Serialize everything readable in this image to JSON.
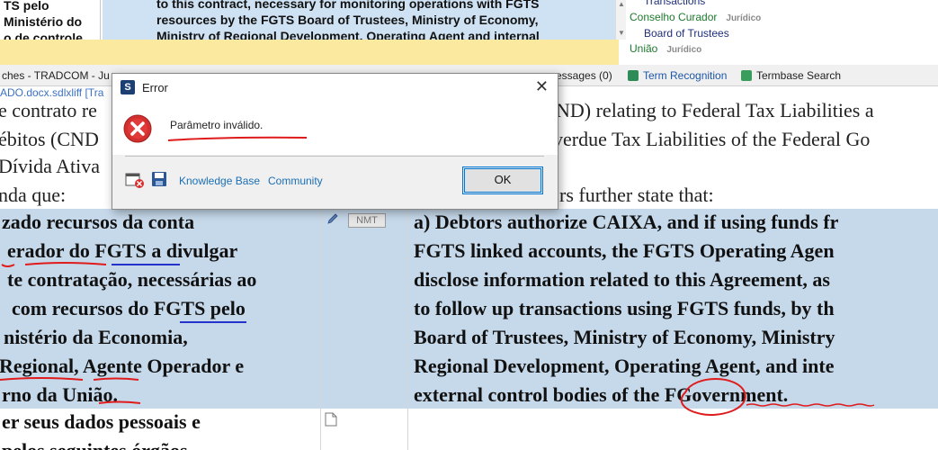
{
  "top_left": {
    "lines": [
      "TS pelo",
      "Ministério do",
      "o de controle"
    ]
  },
  "top_preview": {
    "lines": [
      "to this contract, necessary for monitoring operations with FGTS",
      "resources by the FGTS Board of Trustees, Ministry of Economy,",
      "Ministry of Regional Development, Operating Agent and internal"
    ]
  },
  "termbase": {
    "rows": [
      {
        "term": "Transactions",
        "tag": ""
      },
      {
        "term": "Conselho Curador",
        "tag": "Jurídico"
      },
      {
        "term": "Board of Trustees",
        "tag": ""
      },
      {
        "term": "União",
        "tag": "Jurídico"
      }
    ]
  },
  "tabs": {
    "searches": "ches - TRADCOM - Ju",
    "messages": "essages (0)",
    "term_recognition": "Term Recognition",
    "termbase_search": "Termbase Search"
  },
  "file_tab": "ADO.docx.sdlxliff [Tra",
  "editor": {
    "row1": {
      "src": "e contrato re",
      "tgt": "ND) relating to Federal Tax Liabilities a"
    },
    "row2": {
      "src": "ébitos (CND",
      "tgt": "verdue Tax Liabilities of the Federal Go"
    },
    "row3": {
      "src": "Dívida Ativa",
      "tgt": ""
    },
    "row4": {
      "src": "nda que:",
      "tgt": "rs further state that:"
    },
    "active": {
      "badge": "NMT",
      "src_lines": [
        "zado recursos da conta",
        "erador do FGTS a divulgar",
        "te contratação, necessárias ao",
        "com recursos do FGTS pelo",
        "nistério da Economia,",
        "Regional, Agente Operador e",
        "rno da União."
      ],
      "tgt_lines": [
        "a) Debtors authorize CAIXA, and if using funds fr",
        "FGTS linked accounts, the FGTS Operating Agen",
        "disclose information related to this Agreement, as",
        "to follow up transactions using FGTS funds, by th",
        "Board of Trustees, Ministry of Economy, Ministry",
        "Regional Development, Operating Agent, and inte",
        "external control bodies of the FGovernment."
      ]
    },
    "next": {
      "src_lines": [
        "er seus dados pessoais e",
        "pelos seguintes órgãos"
      ]
    }
  },
  "dialog": {
    "title": "Error",
    "message": "Parâmetro inválido.",
    "knowledge_base": "Knowledge Base",
    "community": "Community",
    "ok": "OK"
  },
  "colors": {
    "active_segment": "#c6d9eb",
    "preview": "#cfe2f3",
    "yellow_band": "#fce9a0",
    "error_red": "#d32f2f",
    "annotation_red": "#e01b1b",
    "link_blue": "#1b6fb5"
  }
}
